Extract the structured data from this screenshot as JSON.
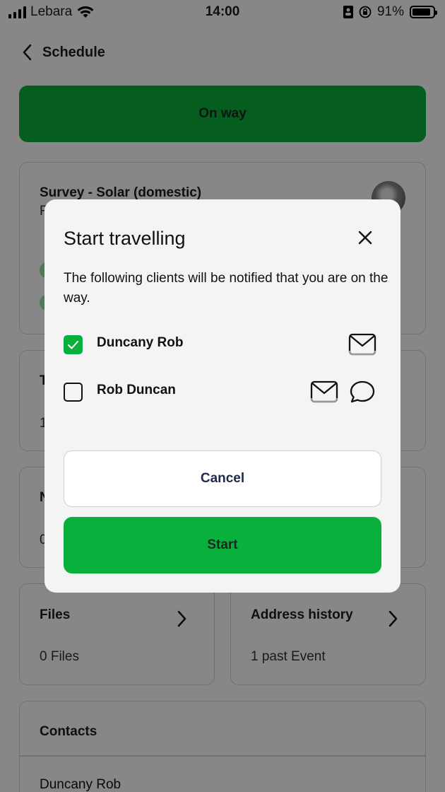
{
  "status_bar": {
    "carrier": "Lebara",
    "time": "14:00",
    "battery": "91%",
    "battery_level": 0.91
  },
  "nav": {
    "back_label": "Schedule"
  },
  "main": {
    "status_button": "On way",
    "job_card": {
      "title": "Survey - Solar (domestic)",
      "subtitle_partial": "F"
    },
    "partial_card_1": {
      "title_partial": "T",
      "value_partial": "1"
    },
    "partial_card_2": {
      "title_partial": "N",
      "value_partial": "0"
    },
    "files": {
      "title": "Files",
      "subtitle": "0 Files"
    },
    "address_history": {
      "title": "Address history",
      "subtitle": "1 past Event"
    },
    "contacts": {
      "title": "Contacts",
      "first": "Duncany Rob"
    }
  },
  "modal": {
    "title": "Start travelling",
    "description": "The following clients will be notified that you are on the way.",
    "clients": [
      {
        "name": "Duncany Rob",
        "checked": true,
        "channels": [
          "mail-icon"
        ]
      },
      {
        "name": "Rob Duncan",
        "checked": false,
        "channels": [
          "mail-icon",
          "chat-bubble-icon"
        ]
      }
    ],
    "cancel_label": "Cancel",
    "start_label": "Start"
  },
  "colors": {
    "primary_green": "#0ab03c",
    "light_green": "#9be3ad",
    "cancel_text": "#1e2a4a"
  }
}
